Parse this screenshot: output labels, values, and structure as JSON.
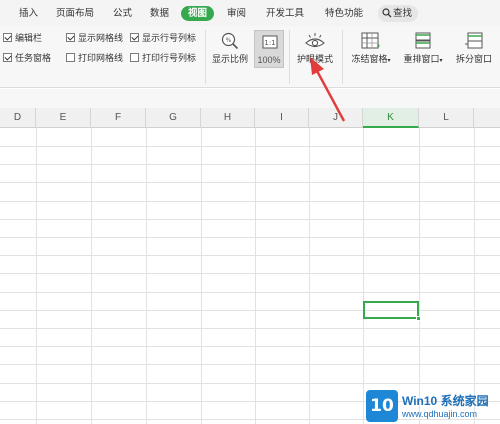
{
  "menu": {
    "tabs": [
      {
        "label": "插入",
        "active": false
      },
      {
        "label": "页面布局",
        "active": false
      },
      {
        "label": "公式",
        "active": false
      },
      {
        "label": "数据",
        "active": false
      },
      {
        "label": "视图",
        "active": true
      },
      {
        "label": "审阅",
        "active": false
      },
      {
        "label": "开发工具",
        "active": false
      },
      {
        "label": "特色功能",
        "active": false
      }
    ],
    "search_label": "查找"
  },
  "ribbon": {
    "checkboxes": [
      {
        "label": "编辑栏",
        "checked": true
      },
      {
        "label": "任务窗格",
        "checked": true
      },
      {
        "label": "显示网格线",
        "checked": true
      },
      {
        "label": "打印网格线",
        "checked": false
      },
      {
        "label": "显示行号列标",
        "checked": true
      },
      {
        "label": "打印行号列标",
        "checked": false
      }
    ],
    "display_ratio_label": "显示比例",
    "zoom_100_label": "100%",
    "eye_protection_label": "护眼模式",
    "freeze_panes_label": "冻结窗格",
    "arrange_windows_label": "重排窗口",
    "split_window_label": "拆分窗口"
  },
  "grid": {
    "columns": [
      "D",
      "E",
      "F",
      "G",
      "H",
      "I",
      "J",
      "K",
      "L"
    ],
    "selected_column": "K"
  },
  "watermark": {
    "logo_text": "10",
    "title": "Win10 系统家园",
    "url": "www.qdhuajin.com"
  },
  "colors": {
    "accent_green": "#36a94e",
    "arrow_red": "#e23b3b",
    "watermark_blue": "#1e6fb8"
  }
}
